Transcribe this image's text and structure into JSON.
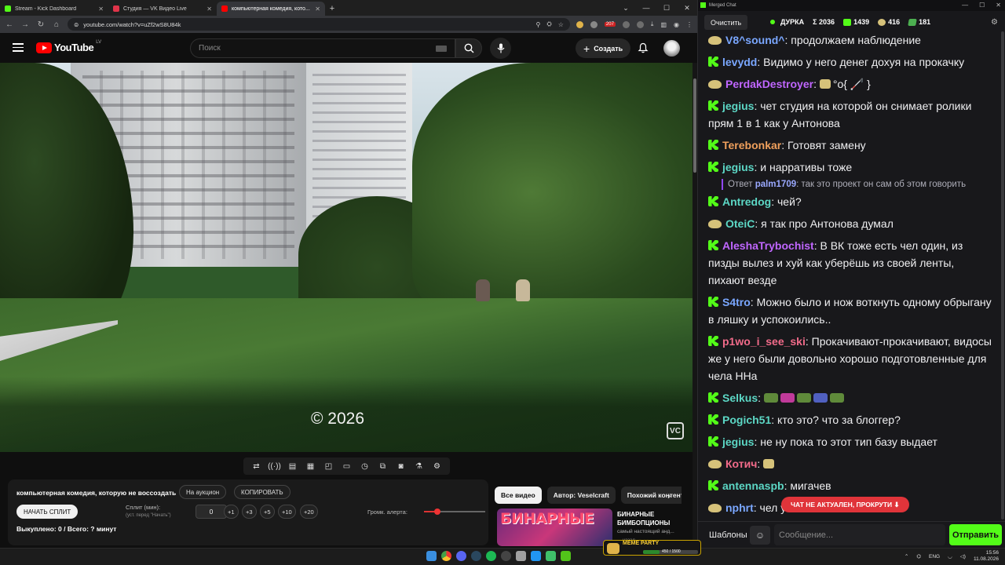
{
  "browser": {
    "tabs": [
      {
        "title": "Stream - Kick Dashboard",
        "color": "#53fc18"
      },
      {
        "title": "Студия — VK Видео Live",
        "color": "#e0344a"
      },
      {
        "title": "компьютерная комедия, кото...",
        "color": "#ff0000"
      }
    ],
    "url": "youtube.com/watch?v=uZf2wS8U84k",
    "ext_badge": "207"
  },
  "youtube": {
    "logo": "YouTube",
    "region": "LV",
    "search_placeholder": "Поиск",
    "create_label": "Создать"
  },
  "video": {
    "overlay_text": "© 2026",
    "watermark": "VC"
  },
  "panel": {
    "title": "компьютерная комедия, которую не воссоздать",
    "auction_btn": "На аукцион",
    "copy_btn": "КОПИРОВАТЬ",
    "start_split_btn": "НАЧАТЬ СПЛИТ",
    "split_label": "Сплит (мин):",
    "split_hint": "(уст. перед \"Начать\")",
    "split_value": "0",
    "increments": [
      "+1",
      "+3",
      "+5",
      "+10",
      "+20"
    ],
    "volume_label": "Громк. алерта:",
    "volume_level": 0.22,
    "summary": "Выкуплено: 0 / Всего: ? минут"
  },
  "recommendations": {
    "chips": [
      "Все видео",
      "Автор: Veselcraft",
      "Похожий контент"
    ],
    "item": {
      "thumb_text": "БИНАРНЫЕ",
      "title": "БИНАРНЫЕ БИМБОПЦИОНЫ",
      "channel": "самый настоящий анд...",
      "meta": "... назад"
    }
  },
  "widget": {
    "title": "MEME PARTY",
    "count": "450 / 1500",
    "progress": 0.3
  },
  "taskbar": {
    "lang": "ENG",
    "time": "15:56",
    "date": "11.08.2026"
  },
  "chat": {
    "window_title": "Merged Chat",
    "clear_btn": "Очистить",
    "channel": "ДУРКА",
    "total": "Σ 2036",
    "kick_count": "1439",
    "vk_count": "416",
    "other_count": "181",
    "messages": [
      {
        "src": "vk",
        "nick": "V8^sound^",
        "color": "#7aa7ff",
        "text": "продолжаем наблюдение"
      },
      {
        "src": "kick",
        "nick": "levydd",
        "color": "#7aa7ff",
        "text": "Видимо у него денег дохуя на прокачку"
      },
      {
        "src": "vk",
        "nick": "PerdakDestroyer",
        "color": "#c066ff",
        "text": "°o{ 🦯 }"
      },
      {
        "src": "kick",
        "nick": "jegius",
        "color": "#5cd7c5",
        "text": "чет студия на которой он снимает ролики прям 1 в 1 как у Антонова"
      },
      {
        "src": "kick",
        "nick": "Terebonkar",
        "color": "#f0a05c",
        "text": "Готовят замену"
      },
      {
        "src": "kick",
        "nick": "jegius",
        "color": "#5cd7c5",
        "text": "и нарративы тоже"
      },
      {
        "src": "kick",
        "nick": "Antredog",
        "color": "#5cd7c5",
        "text": "чей?"
      },
      {
        "src": "vk",
        "nick": "OteiC",
        "color": "#5cd7c5",
        "text": "я так про Антонова думал"
      },
      {
        "src": "kick",
        "nick": "AleshaTrybochist",
        "color": "#c066ff",
        "text": "В ВК тоже есть чел один, из пизды вылез и хуй как уберёшь из своей ленты, пихают везде"
      },
      {
        "src": "kick",
        "nick": "S4tro",
        "color": "#7aa7ff",
        "text": "Можно было и нож воткнуть одному обрыгану в ляшку и успокоились.."
      },
      {
        "src": "kick",
        "nick": "p1wo_i_see_ski",
        "color": "#f26b8a",
        "text": "Прокачивают-прокачивают, видосы же у него были довольно хорошо подготовленные для чела ННа"
      },
      {
        "src": "kick",
        "nick": "Selkus",
        "color": "#5cd7c5",
        "text": ""
      },
      {
        "src": "kick",
        "nick": "Pogich51",
        "color": "#5cd7c5",
        "text": "кто это? что за блоггер?"
      },
      {
        "src": "kick",
        "nick": "jegius",
        "color": "#5cd7c5",
        "text": "не ну пока то этот тип базу выдает"
      },
      {
        "src": "vk",
        "nick": "Котич",
        "color": "#f26b8a",
        "text": ""
      },
      {
        "src": "kick",
        "nick": "antennaspb",
        "color": "#5cd7c5",
        "text": "мигачев"
      },
      {
        "src": "vk",
        "nick": "nphrt",
        "color": "#7aa7ff",
        "text": "чел                                    успешный"
      }
    ],
    "reply": {
      "label": "Ответ",
      "nick": "palm1709",
      "text": ": так это проект он сам об этом говорить"
    },
    "notice": "ЧАТ НЕ АКТУАЛЕН, ПРОКРУТИ ⬇",
    "templates_btn": "Шаблоны",
    "input_placeholder": "Сообщение...",
    "send_btn": "Отправить"
  }
}
